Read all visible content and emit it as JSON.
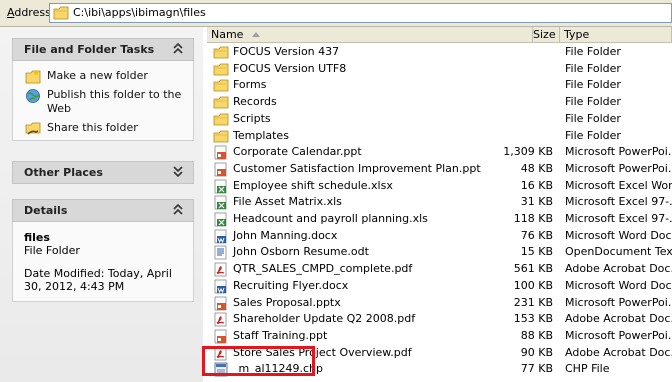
{
  "address": {
    "label_prefix": "A",
    "label_rest": "ddress",
    "path": "C:\\ibi\\apps\\ibimagn\\files"
  },
  "file_tasks": {
    "title": "File and Folder Tasks",
    "items": [
      {
        "label": "Make a new folder",
        "icon": "new-folder-icon"
      },
      {
        "label": "Publish this folder to the Web",
        "icon": "publish-web-icon"
      },
      {
        "label": "Share this folder",
        "icon": "share-folder-icon"
      }
    ]
  },
  "other_places": {
    "title": "Other Places"
  },
  "details": {
    "title": "Details",
    "name": "files",
    "kind": "File Folder",
    "modified": "Date Modified: Today, April 30, 2012, 4:43 PM"
  },
  "columns": {
    "name": "Name",
    "size": "Size",
    "type": "Type"
  },
  "files": [
    {
      "name": "FOCUS Version 437",
      "size": "",
      "type": "File Folder",
      "icon": "folder"
    },
    {
      "name": "FOCUS Version UTF8",
      "size": "",
      "type": "File Folder",
      "icon": "folder"
    },
    {
      "name": "Forms",
      "size": "",
      "type": "File Folder",
      "icon": "folder"
    },
    {
      "name": "Records",
      "size": "",
      "type": "File Folder",
      "icon": "folder"
    },
    {
      "name": "Scripts",
      "size": "",
      "type": "File Folder",
      "icon": "folder"
    },
    {
      "name": "Templates",
      "size": "",
      "type": "File Folder",
      "icon": "folder"
    },
    {
      "name": "Corporate Calendar.ppt",
      "size": "1,309 KB",
      "type": "Microsoft PowerPoi...",
      "icon": "ppt"
    },
    {
      "name": "Customer Satisfaction Improvement Plan.ppt",
      "size": "48 KB",
      "type": "Microsoft PowerPoi...",
      "icon": "ppt"
    },
    {
      "name": "Employee shift schedule.xlsx",
      "size": "16 KB",
      "type": "Microsoft Excel Wor...",
      "icon": "xls"
    },
    {
      "name": "File Asset Matrix.xls",
      "size": "31 KB",
      "type": "Microsoft Excel 97-...",
      "icon": "xls"
    },
    {
      "name": "Headcount and payroll planning.xls",
      "size": "118 KB",
      "type": "Microsoft Excel 97-...",
      "icon": "xls"
    },
    {
      "name": "John Manning.docx",
      "size": "76 KB",
      "type": "Microsoft Word Doc...",
      "icon": "doc"
    },
    {
      "name": "John Osborn Resume.odt",
      "size": "15 KB",
      "type": "OpenDocument Text",
      "icon": "odt"
    },
    {
      "name": "QTR_SALES_CMPD_complete.pdf",
      "size": "561 KB",
      "type": "Adobe Acrobat Doc...",
      "icon": "pdf"
    },
    {
      "name": "Recruiting Flyer.docx",
      "size": "100 KB",
      "type": "Microsoft Word Doc...",
      "icon": "doc"
    },
    {
      "name": "Sales Proposal.pptx",
      "size": "231 KB",
      "type": "Microsoft PowerPoi...",
      "icon": "ppt"
    },
    {
      "name": "Shareholder Update Q2 2008.pdf",
      "size": "153 KB",
      "type": "Adobe Acrobat Doc...",
      "icon": "pdf"
    },
    {
      "name": "Staff Training.ppt",
      "size": "88 KB",
      "type": "Microsoft PowerPoi...",
      "icon": "ppt"
    },
    {
      "name": "Store Sales Project Overview.pdf",
      "size": "90 KB",
      "type": "Adobe Acrobat Doc...",
      "icon": "pdf"
    },
    {
      "name": "_m_al11249.chp",
      "size": "77 KB",
      "type": "CHP File",
      "icon": "chp"
    }
  ],
  "colors": {
    "highlight": "#e3161e",
    "pane_bg": "#eaeaea",
    "toolbar_bg": "#ece9d8"
  }
}
